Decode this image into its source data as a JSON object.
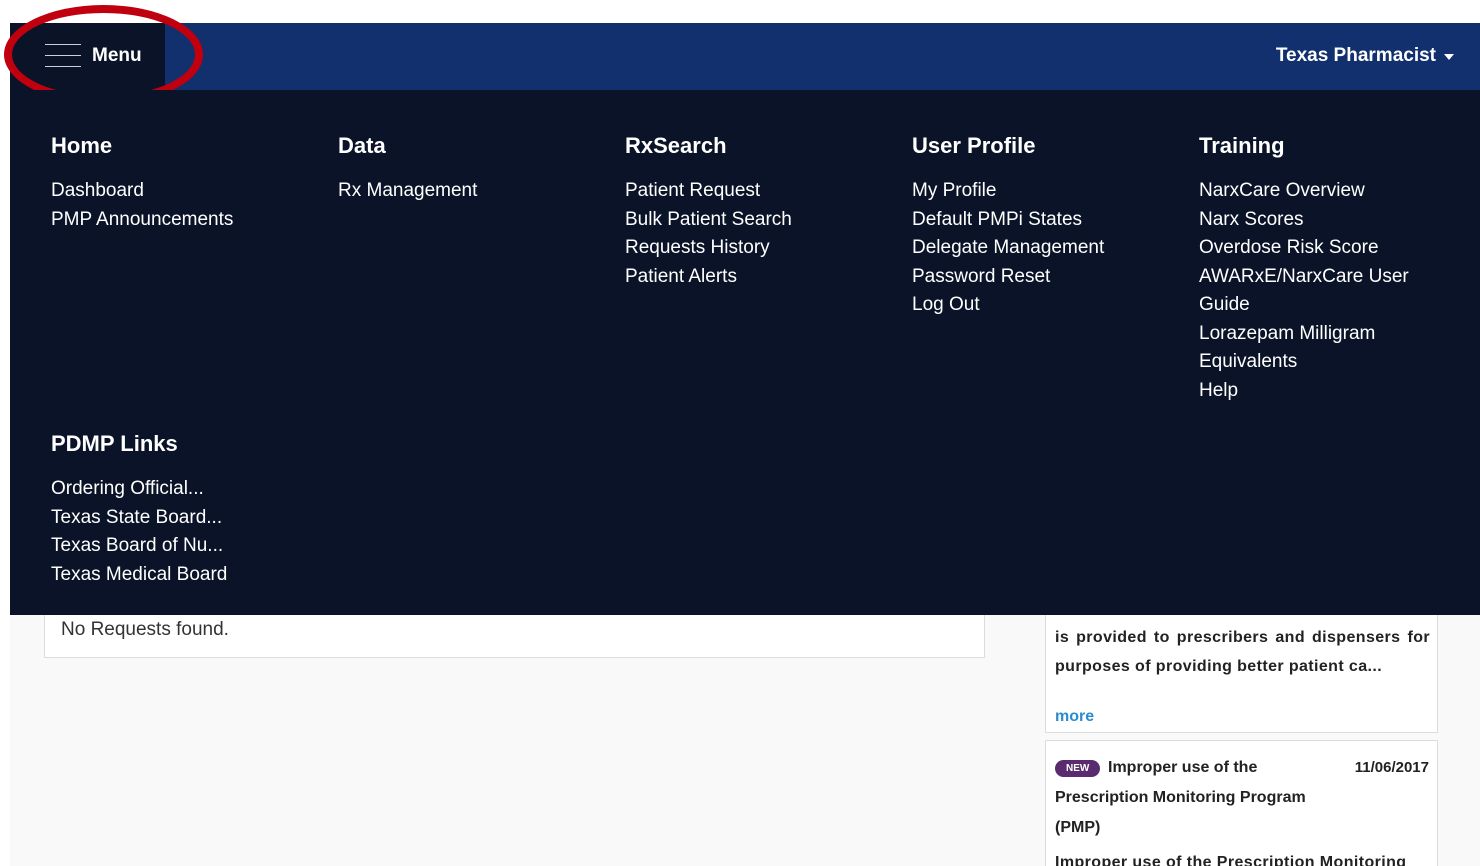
{
  "header": {
    "menu_label": "Menu",
    "user_name": "Texas Pharmacist"
  },
  "menu": {
    "home": {
      "title": "Home",
      "items": [
        "Dashboard",
        "PMP Announcements"
      ]
    },
    "data": {
      "title": "Data",
      "items": [
        "Rx Management"
      ]
    },
    "rxsearch": {
      "title": "RxSearch",
      "items": [
        "Patient Request",
        "Bulk Patient Search",
        "Requests History",
        "Patient Alerts"
      ]
    },
    "user_profile": {
      "title": "User Profile",
      "items": [
        "My Profile",
        "Default PMPi States",
        "Delegate Management",
        "Password Reset",
        "Log Out"
      ]
    },
    "training": {
      "title": "Training",
      "items": [
        "NarxCare Overview",
        "Narx Scores",
        "Overdose Risk Score",
        "AWARxE/NarxCare User Guide",
        "Lorazepam Milligram Equivalents",
        "Help"
      ]
    },
    "pdmp_links": {
      "title": "PDMP Links",
      "items": [
        "Ordering Official...",
        "Texas State Board...",
        "Texas Board of Nu...",
        "Texas Medical Board"
      ]
    }
  },
  "requests": {
    "empty_message": "No Requests found."
  },
  "announcements": {
    "first_excerpt": "is provided to prescribers and dispensers for purposes of providing better patient ca...",
    "more_label": "more",
    "second": {
      "badge": "NEW",
      "title": "Improper use of the Prescription Monitoring Program (PMP)",
      "date": "11/06/2017",
      "excerpt": "Improper use of the Prescription Monitoring"
    }
  },
  "colors": {
    "header_bg": "#12306e",
    "menu_bg": "#0a1327",
    "highlight_ring": "#c0000e",
    "link_blue": "#2a8bd1",
    "badge_bg": "#5a2b6f"
  }
}
